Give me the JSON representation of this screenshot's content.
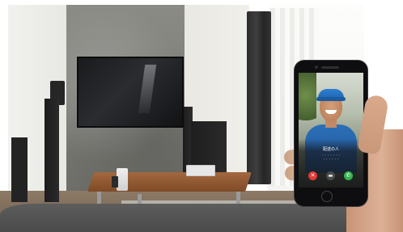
{
  "phone": {
    "caller_name": "配送の人",
    "call_info_lines": [
      "・・・・・・・",
      "・・・・・・"
    ],
    "buttons": [
      {
        "name": "decline",
        "icon": "phone-decline-icon",
        "glyph": "✕",
        "color": "#e03a34"
      },
      {
        "name": "message",
        "icon": "message-icon",
        "glyph": "▬",
        "color": "#ffffff"
      },
      {
        "name": "answer",
        "icon": "phone-answer-icon",
        "glyph": "✆",
        "color": "#33b24a"
      }
    ]
  }
}
